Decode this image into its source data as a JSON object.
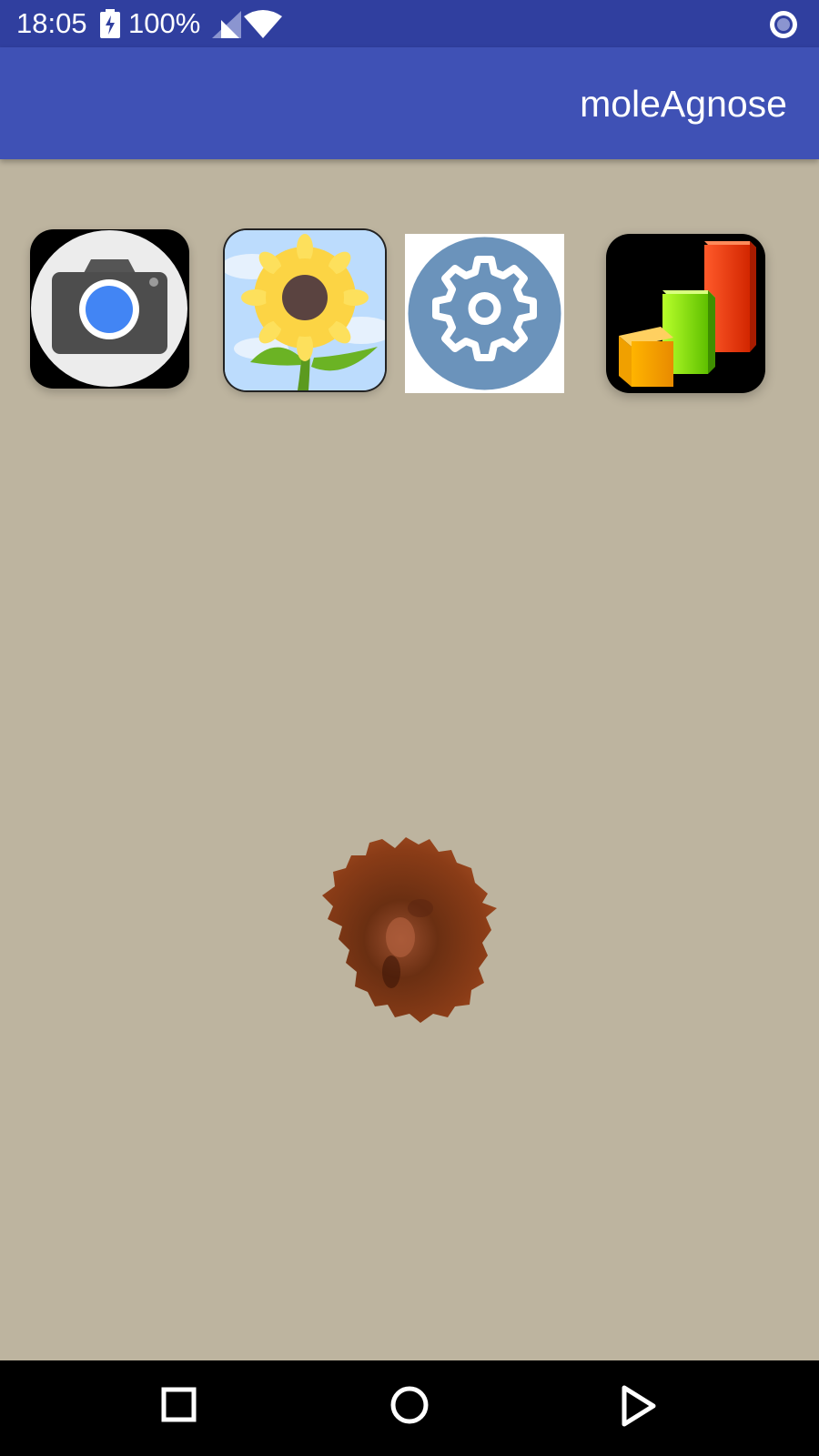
{
  "status_bar": {
    "time": "18:05",
    "battery_percent": "100%",
    "icons": [
      "battery-charging-icon",
      "cell-signal-icon",
      "wifi-icon",
      "screen-record-icon"
    ],
    "background": "#303f9f"
  },
  "app_bar": {
    "title": "moleAgnose",
    "background": "#3f51b5"
  },
  "content": {
    "background": "#bdb49f",
    "buttons": [
      {
        "icon": "camera-icon"
      },
      {
        "icon": "sunflower-gallery-icon"
      },
      {
        "icon": "gear-settings-icon"
      },
      {
        "icon": "bar-chart-icon"
      }
    ],
    "image": "mole-image"
  },
  "nav_bar": {
    "buttons": [
      "recents-icon",
      "home-icon",
      "back-icon"
    ],
    "background": "#000000"
  }
}
